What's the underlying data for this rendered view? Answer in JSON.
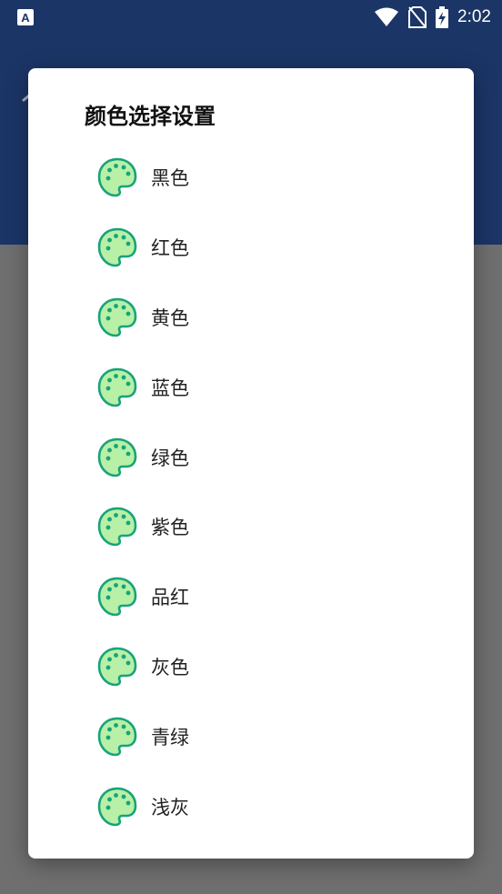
{
  "status_bar": {
    "time": "2:02",
    "left_icon": "a-notification-icon",
    "icons": [
      "wifi-icon",
      "no-sim-icon",
      "battery-charging-icon"
    ]
  },
  "app_bar": {
    "back_icon": "back-arrow-icon",
    "color": "#1b3566"
  },
  "dialog": {
    "title": "颜色选择设置",
    "options": [
      {
        "label": "黑色"
      },
      {
        "label": "红色"
      },
      {
        "label": "黄色"
      },
      {
        "label": "蓝色"
      },
      {
        "label": "绿色"
      },
      {
        "label": "紫色"
      },
      {
        "label": "品红"
      },
      {
        "label": "灰色"
      },
      {
        "label": "青绿"
      },
      {
        "label": "浅灰"
      }
    ],
    "option_icon": "palette-icon",
    "icon_fill": "#b7f0a6",
    "icon_stroke": "#18a37a"
  }
}
